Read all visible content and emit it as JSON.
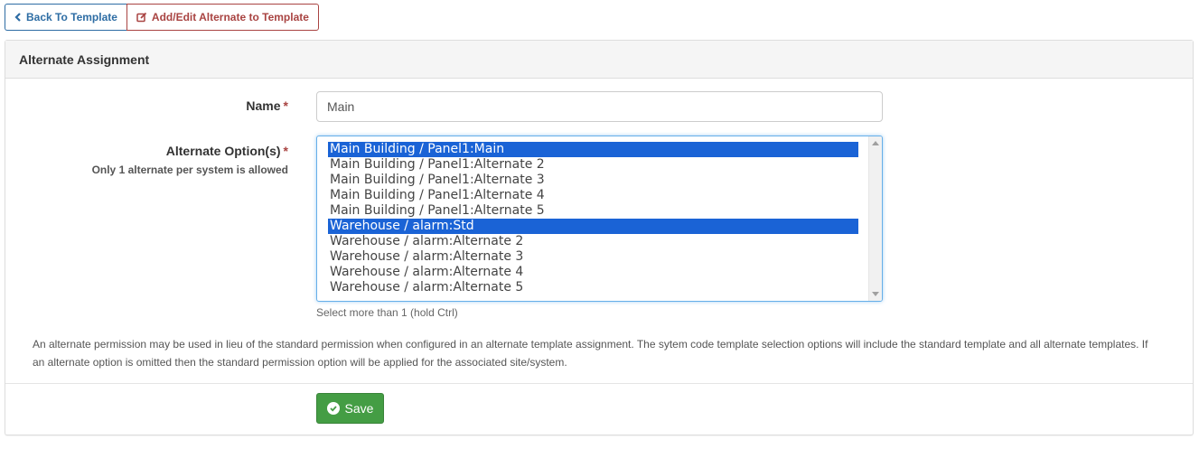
{
  "tabs": {
    "back_label": "Back To Template",
    "active_label": "Add/Edit Alternate to Template"
  },
  "panel": {
    "title": "Alternate Assignment"
  },
  "form": {
    "name_label": "Name",
    "required_mark": "*",
    "name_value": "Main",
    "options_label": "Alternate Option(s)",
    "options_sublabel": "Only 1 alternate per system is allowed",
    "options": [
      {
        "label": "Main Building / Panel1:Main",
        "selected": true
      },
      {
        "label": "Main Building / Panel1:Alternate 2",
        "selected": false
      },
      {
        "label": "Main Building / Panel1:Alternate 3",
        "selected": false
      },
      {
        "label": "Main Building / Panel1:Alternate 4",
        "selected": false
      },
      {
        "label": "Main Building / Panel1:Alternate 5",
        "selected": false
      },
      {
        "label": "Warehouse / alarm:Std",
        "selected": true
      },
      {
        "label": "Warehouse / alarm:Alternate 2",
        "selected": false
      },
      {
        "label": "Warehouse / alarm:Alternate 3",
        "selected": false
      },
      {
        "label": "Warehouse / alarm:Alternate 4",
        "selected": false
      },
      {
        "label": "Warehouse / alarm:Alternate 5",
        "selected": false
      }
    ],
    "options_help": "Select more than 1 (hold Ctrl)",
    "description": "An alternate permission may be used in lieu of the standard permission when configured in an alternate template assignment. The sytem code template selection options will include the standard template and all alternate templates. If an alternate option is omitted then the standard permission option will be applied for the associated site/system.",
    "save_label": "Save"
  },
  "colors": {
    "primary": "#2e6da4",
    "danger": "#a94442",
    "success": "#449d44",
    "selection": "#1a63d6"
  },
  "icons": {
    "back": "chevron-left-icon",
    "edit": "edit-square-icon",
    "save": "check-circle-icon"
  }
}
